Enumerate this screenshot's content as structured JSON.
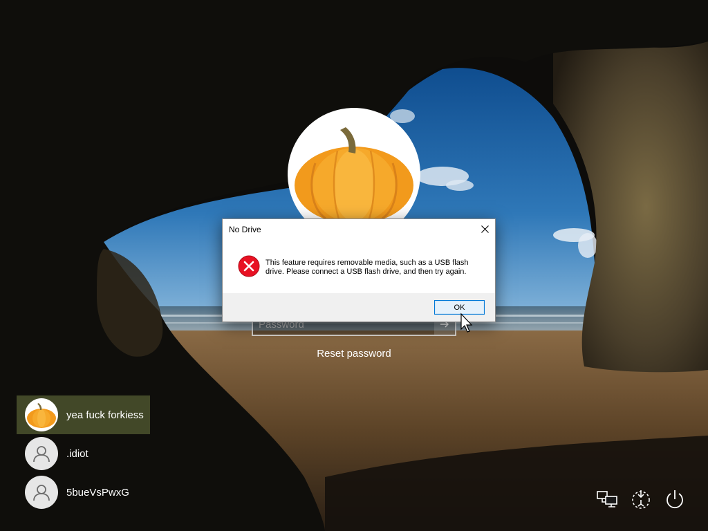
{
  "login": {
    "password_placeholder": "Password",
    "reset_password": "Reset password"
  },
  "dialog": {
    "title": "No Drive",
    "message": "This feature requires removable media, such as a USB flash drive. Please connect a USB flash drive, and then try again.",
    "ok_label": "OK",
    "icon": "error-icon",
    "close_icon": "close-icon"
  },
  "users": [
    {
      "name": "yea fuck forkiess",
      "avatar": "pumpkin-photo",
      "selected": true
    },
    {
      "name": ".idiot",
      "avatar": "generic-user-icon",
      "selected": false
    },
    {
      "name": "5bueVsPwxG",
      "avatar": "generic-user-icon",
      "selected": false
    }
  ],
  "tray": [
    {
      "icon": "network-icon"
    },
    {
      "icon": "ease-of-access-icon"
    },
    {
      "icon": "power-icon"
    }
  ],
  "colors": {
    "selected_user_bg": "#4e562e",
    "ok_button_border": "#0078d7",
    "error_red": "#e81123",
    "pumpkin": "#f29a1c"
  }
}
